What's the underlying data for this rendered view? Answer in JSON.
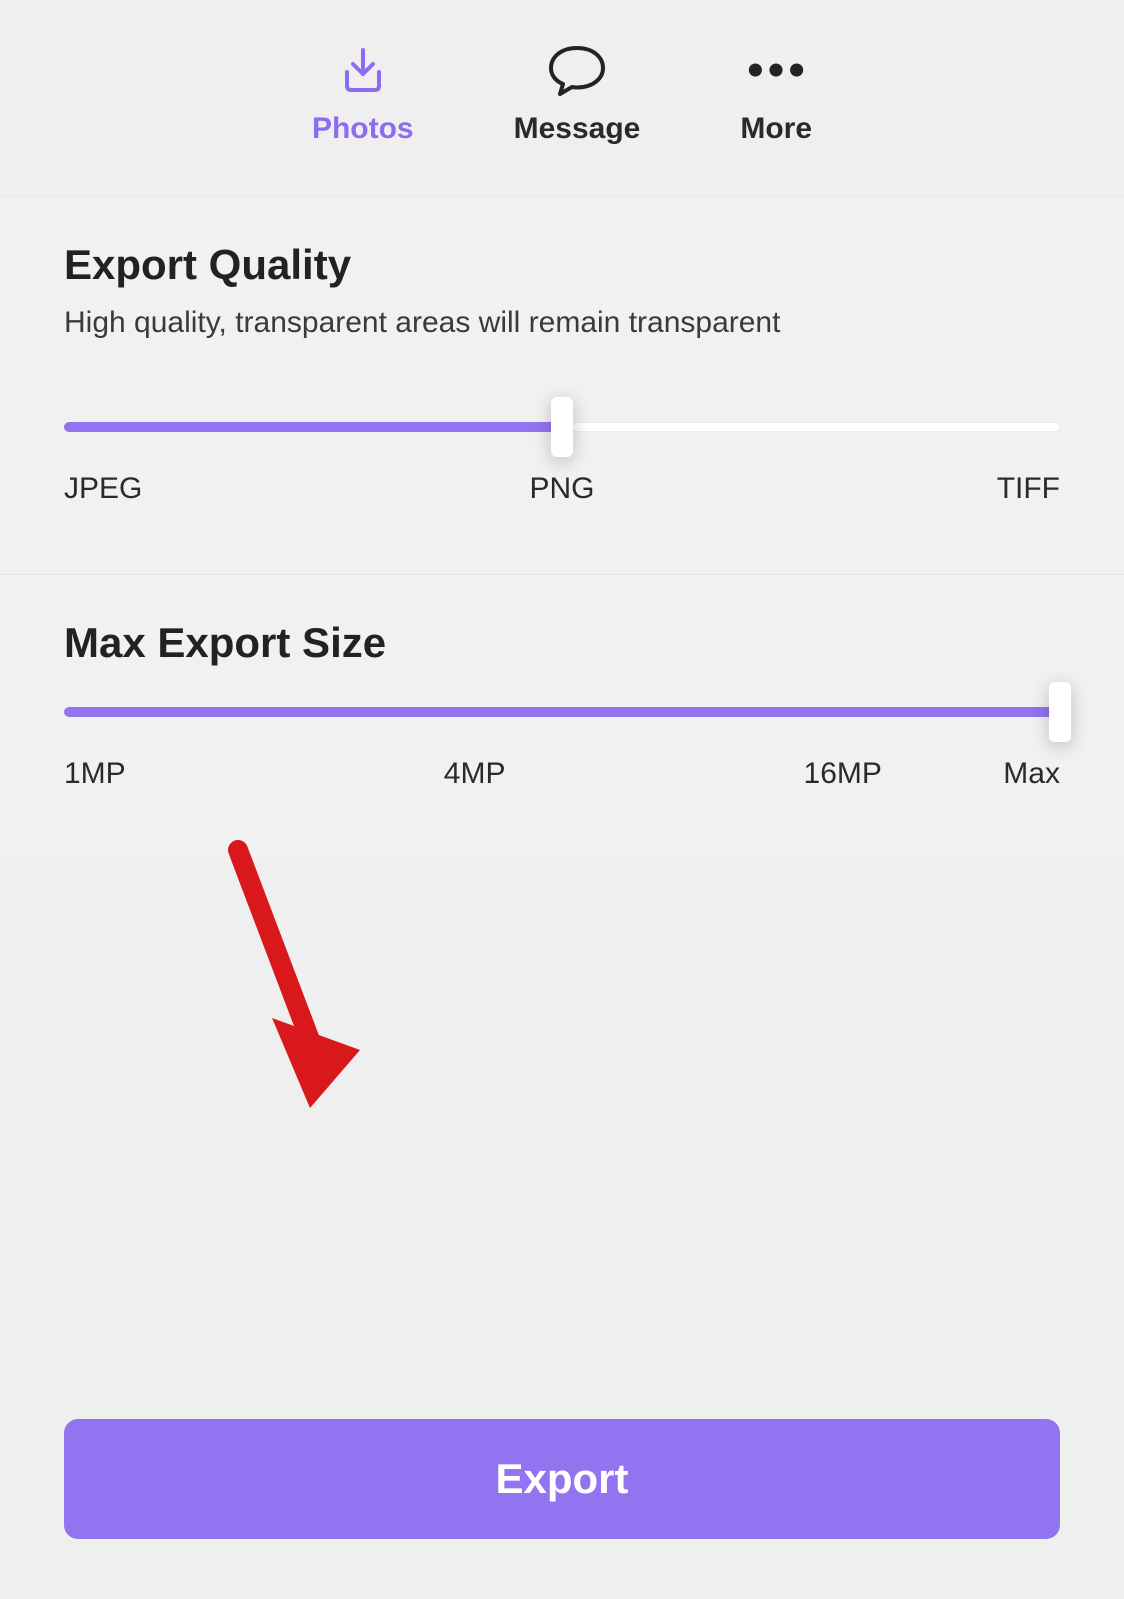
{
  "tabs": {
    "photos": {
      "label": "Photos"
    },
    "message": {
      "label": "Message"
    },
    "more": {
      "label": "More"
    }
  },
  "quality": {
    "title": "Export Quality",
    "desc": "High quality, transparent areas will remain transparent",
    "labels": {
      "left": "JPEG",
      "mid": "PNG",
      "right": "TIFF"
    },
    "value_percent": 50
  },
  "size": {
    "title": "Max Export Size",
    "labels": {
      "a": "1MP",
      "b": "4MP",
      "c": "16MP",
      "d": "Max"
    },
    "value_percent": 100
  },
  "export": {
    "label": "Export"
  },
  "colors": {
    "accent": "#9273f0"
  }
}
